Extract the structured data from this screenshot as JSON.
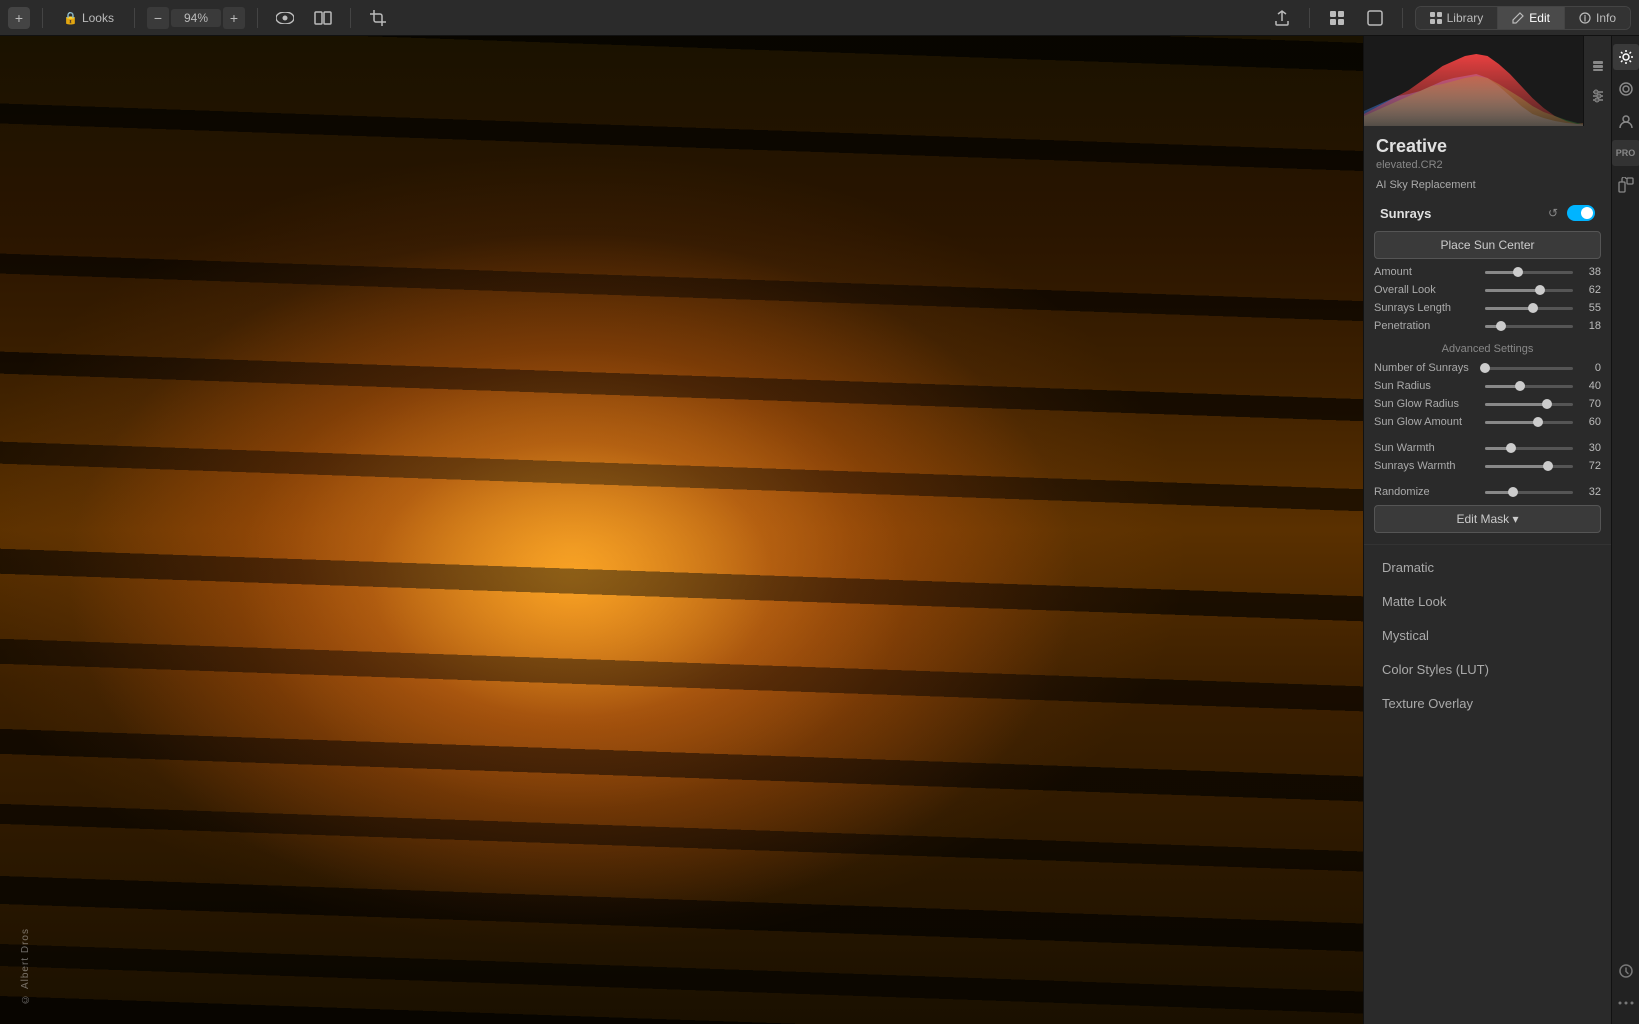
{
  "toolbar": {
    "add_label": "+",
    "looks_label": "Looks",
    "zoom_value": "94%",
    "zoom_minus": "−",
    "zoom_plus": "+",
    "tabs": [
      {
        "id": "library",
        "label": "Library",
        "active": false
      },
      {
        "id": "edit",
        "label": "Edit",
        "active": true
      },
      {
        "id": "info",
        "label": "Info",
        "active": false
      }
    ]
  },
  "panel": {
    "title": "Creative",
    "subtitle": "elevated.CR2",
    "section_label": "AI Sky Replacement",
    "sunrays": {
      "section_title": "Sunrays",
      "place_sun_center_btn": "Place Sun Center",
      "sliders": [
        {
          "label": "Amount",
          "value": 38,
          "pct": 38
        },
        {
          "label": "Overall Look",
          "value": 62,
          "pct": 62
        },
        {
          "label": "Sunrays Length",
          "value": 55,
          "pct": 55
        },
        {
          "label": "Penetration",
          "value": 18,
          "pct": 18
        }
      ],
      "advanced_label": "Advanced Settings",
      "advanced_sliders": [
        {
          "label": "Number of Sunrays",
          "value": 0,
          "pct": 0
        },
        {
          "label": "Sun Radius",
          "value": 40,
          "pct": 40
        },
        {
          "label": "Sun Glow Radius",
          "value": 70,
          "pct": 70
        },
        {
          "label": "Sun Glow Amount",
          "value": 60,
          "pct": 60
        },
        {
          "label": "Sun Warmth",
          "value": 30,
          "pct": 30
        },
        {
          "label": "Sunrays Warmth",
          "value": 72,
          "pct": 72
        },
        {
          "label": "Randomize",
          "value": 32,
          "pct": 32
        }
      ],
      "edit_mask_btn": "Edit Mask ▾"
    },
    "categories": [
      "Dramatic",
      "Matte Look",
      "Mystical",
      "Color Styles (LUT)",
      "Texture Overlay"
    ]
  },
  "watermark": "© Albert Dros",
  "colors": {
    "accent": "#00b4ff",
    "toggle_on": "#00b4ff",
    "slider_track": "#555",
    "slider_thumb": "#ccc"
  }
}
